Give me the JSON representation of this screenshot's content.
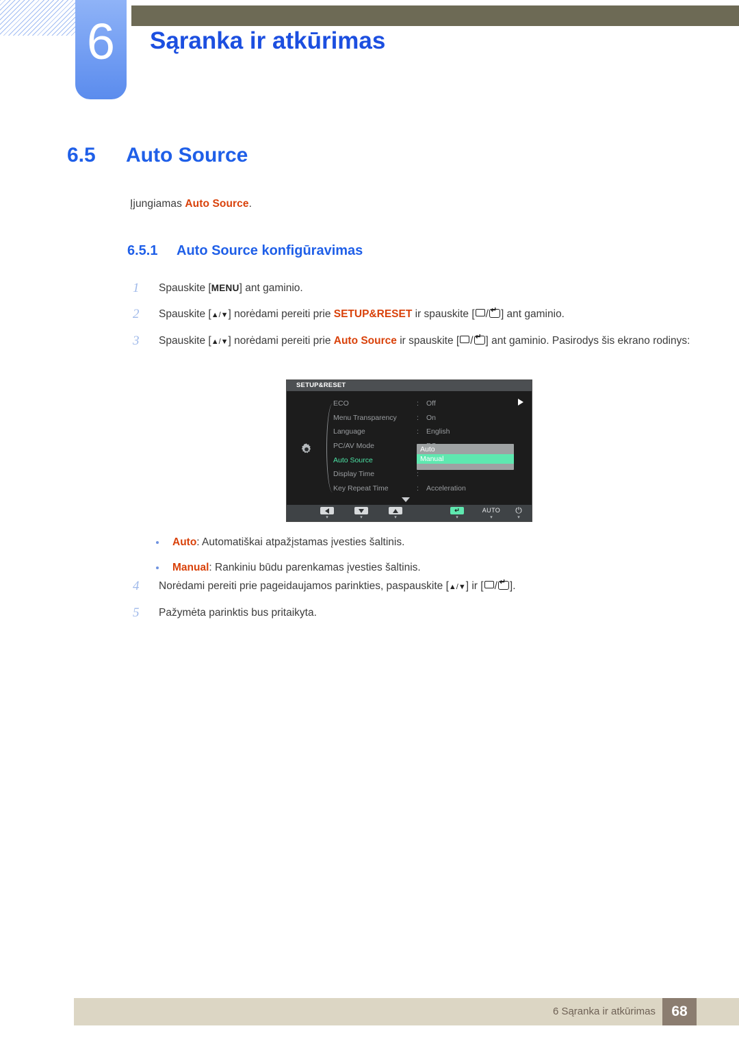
{
  "header": {
    "chapter_number": "6",
    "chapter_title": "Sąranka ir atkūrimas"
  },
  "section": {
    "number": "6.5",
    "title": "Auto Source",
    "intro_prefix": "Įjungiamas ",
    "intro_keyword": "Auto Source",
    "intro_suffix": ".",
    "subsection_number": "6.5.1",
    "subsection_title": "Auto Source konfigūravimas"
  },
  "steps": [
    {
      "num": "1",
      "parts": [
        {
          "t": "text",
          "v": "Spauskite ["
        },
        {
          "t": "menukey",
          "v": "MENU"
        },
        {
          "t": "text",
          "v": "] ant gaminio."
        }
      ]
    },
    {
      "num": "2",
      "parts": [
        {
          "t": "text",
          "v": "Spauskite ["
        },
        {
          "t": "arrows",
          "v": "▲/▼"
        },
        {
          "t": "text",
          "v": "] norėdami pereiti prie "
        },
        {
          "t": "kw",
          "v": "SETUP&RESET"
        },
        {
          "t": "text",
          "v": " ir spauskite ["
        },
        {
          "t": "boxglyph",
          "v": ""
        },
        {
          "t": "text",
          "v": "/"
        },
        {
          "t": "enterglyph",
          "v": ""
        },
        {
          "t": "text",
          "v": "] ant gaminio."
        }
      ]
    },
    {
      "num": "3",
      "parts": [
        {
          "t": "text",
          "v": "Spauskite ["
        },
        {
          "t": "arrows",
          "v": "▲/▼"
        },
        {
          "t": "text",
          "v": "] norėdami pereiti prie "
        },
        {
          "t": "kw",
          "v": "Auto Source"
        },
        {
          "t": "text",
          "v": " ir spauskite ["
        },
        {
          "t": "boxglyph",
          "v": ""
        },
        {
          "t": "text",
          "v": "/"
        },
        {
          "t": "enterglyph",
          "v": ""
        },
        {
          "t": "text",
          "v": "] ant gaminio. Pasirodys šis ekrano rodinys:"
        }
      ]
    }
  ],
  "osd": {
    "title": "SETUP&RESET",
    "gear_icon": "gear-icon",
    "rows": [
      {
        "label": "ECO",
        "sep": ":",
        "value": "Off",
        "active": false
      },
      {
        "label": "Menu Transparency",
        "sep": ":",
        "value": "On",
        "active": false
      },
      {
        "label": "Language",
        "sep": ":",
        "value": "English",
        "active": false
      },
      {
        "label": "PC/AV Mode",
        "sep": ":",
        "value": "PC",
        "active": false
      },
      {
        "label": "Auto Source",
        "sep": ":",
        "value": "",
        "active": true
      },
      {
        "label": "Display Time",
        "sep": ":",
        "value": "",
        "active": false
      },
      {
        "label": "Key Repeat Time",
        "sep": ":",
        "value": "Acceleration",
        "active": false
      }
    ],
    "popup_options": [
      {
        "label": "Auto",
        "selected": false
      },
      {
        "label": "Manual",
        "selected": true
      }
    ],
    "footer_keys": [
      {
        "name": "left-arrow-key",
        "kind": "left",
        "label": ""
      },
      {
        "name": "down-arrow-key",
        "kind": "down",
        "label": ""
      },
      {
        "name": "up-arrow-key",
        "kind": "up",
        "label": ""
      },
      {
        "name": "enter-key",
        "kind": "enter",
        "label": "↵"
      },
      {
        "name": "auto-key",
        "kind": "text",
        "label": "AUTO"
      },
      {
        "name": "power-key",
        "kind": "power",
        "label": "⏻"
      }
    ]
  },
  "bullets": [
    {
      "keyword": "Auto",
      "text": ": Automatiškai atpažįstamas įvesties šaltinis."
    },
    {
      "keyword": "Manual",
      "text": ": Rankiniu būdu parenkamas įvesties šaltinis."
    }
  ],
  "steps2": [
    {
      "num": "4",
      "parts": [
        {
          "t": "text",
          "v": "Norėdami pereiti prie pageidaujamos parinkties, paspauskite ["
        },
        {
          "t": "arrows",
          "v": "▲/▼"
        },
        {
          "t": "text",
          "v": "] ir ["
        },
        {
          "t": "boxglyph",
          "v": ""
        },
        {
          "t": "text",
          "v": "/"
        },
        {
          "t": "enterglyph",
          "v": ""
        },
        {
          "t": "text",
          "v": "]."
        }
      ]
    },
    {
      "num": "5",
      "parts": [
        {
          "t": "text",
          "v": "Pažymėta parinktis bus pritaikyta."
        }
      ]
    }
  ],
  "footer": {
    "text": "6 Sąranka ir atkūrimas",
    "page": "68"
  },
  "colors": {
    "heading_blue": "#1f5fe8",
    "keyword_orange": "#d9420b",
    "chapter_tab": "#6f9bf2",
    "olive_bar": "#6d6a55",
    "footer_bar": "#dcd6c4",
    "footer_page_box": "#8b7d70",
    "osd_highlight_green": "#5fe8b0"
  }
}
